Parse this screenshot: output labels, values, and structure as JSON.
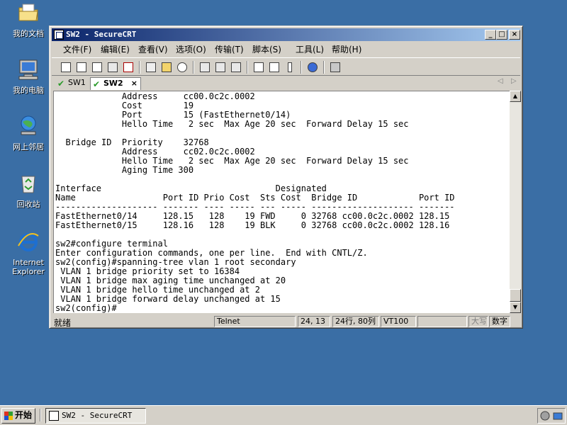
{
  "desktop": {
    "icons": [
      {
        "label": "我的文档",
        "icon": "folder-icon"
      },
      {
        "label": "我的电脑",
        "icon": "computer-icon"
      },
      {
        "label": "网上邻居",
        "icon": "network-icon"
      },
      {
        "label": "回收站",
        "icon": "recycle-bin-icon"
      },
      {
        "label": "Internet Explorer",
        "icon": "internet-explorer-icon"
      }
    ]
  },
  "window": {
    "title": "SW2 - SecureCRT",
    "caption": {
      "minimize": "_",
      "maximize": "□",
      "close": "×"
    },
    "menu": [
      "文件(F)",
      "编辑(E)",
      "查看(V)",
      "选项(O)",
      "传输(T)",
      "脚本(S)",
      "工具(L)",
      "帮助(H)"
    ],
    "toolbar_icons": [
      "connect-icon",
      "quick-connect-icon",
      "connect-tab-icon",
      "reconnect-icon",
      "disconnect-icon",
      "copy-icon",
      "paste-icon",
      "find-icon",
      "print-icon",
      "print-setup-icon",
      "print-screen-icon",
      "session-options-icon",
      "global-options-icon",
      "keymap-icon",
      "help-icon",
      "sftp-icon"
    ],
    "tabs": [
      {
        "label": "SW1",
        "active": false
      },
      {
        "label": "SW2",
        "active": true,
        "close": "×"
      }
    ],
    "terminal_lines": [
      "             Address     cc00.0c2c.0002",
      "             Cost        19",
      "             Port        15 (FastEthernet0/14)",
      "             Hello Time   2 sec  Max Age 20 sec  Forward Delay 15 sec",
      "",
      "  Bridge ID  Priority    32768",
      "             Address     cc02.0c2c.0002",
      "             Hello Time   2 sec  Max Age 20 sec  Forward Delay 15 sec",
      "             Aging Time 300",
      "",
      "Interface                                  Designated",
      "Name                 Port ID Prio Cost  Sts Cost  Bridge ID            Port ID",
      "-------------------- ------- ---- ----- --- ----- -------------------- -------",
      "FastEthernet0/14     128.15   128    19 FWD     0 32768 cc00.0c2c.0002 128.15",
      "FastEthernet0/15     128.16   128    19 BLK     0 32768 cc00.0c2c.0002 128.16",
      "",
      "sw2#configure terminal",
      "Enter configuration commands, one per line.  End with CNTL/Z.",
      "sw2(config)#spanning-tree vlan 1 root secondary",
      " VLAN 1 bridge priority set to 16384",
      " VLAN 1 bridge max aging time unchanged at 20",
      " VLAN 1 bridge hello time unchanged at 2",
      " VLAN 1 bridge forward delay unchanged at 15",
      "sw2(config)#"
    ],
    "status": {
      "ready": "就绪",
      "protocol": "Telnet",
      "cursor": "24, 13",
      "size": "24行, 80列",
      "emulation": "VT100",
      "blank": "",
      "caps": "大写",
      "num": "数字"
    }
  },
  "taskbar": {
    "start_label": "开始",
    "task_label": "SW2 - SecureCRT"
  }
}
